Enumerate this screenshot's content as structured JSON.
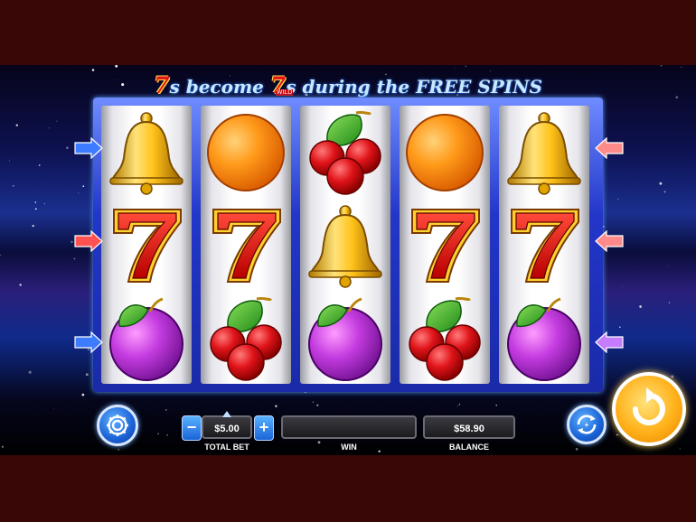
{
  "banner": {
    "seven_glyph": "7",
    "part1": "s become ",
    "wild_tag": "WILD",
    "part2": "s during the FREE SPINS"
  },
  "reels": [
    [
      "bell",
      "seven",
      "plum"
    ],
    [
      "orange",
      "seven",
      "cherry"
    ],
    [
      "cherry",
      "bell",
      "plum"
    ],
    [
      "orange",
      "seven",
      "cherry"
    ],
    [
      "bell",
      "seven",
      "plum"
    ]
  ],
  "paylines": {
    "left": [
      "blue",
      "red",
      "blue"
    ],
    "right": [
      "pink",
      "pink",
      "purple"
    ]
  },
  "colors": {
    "blue": "#3d7bff",
    "red": "#ff5252",
    "pink": "#ff8a8a",
    "purple": "#c67cff"
  },
  "controls": {
    "settings_icon": "gear-icon",
    "bet_minus": "−",
    "bet_plus": "+",
    "total_bet_value": "$5.00",
    "total_bet_label": "TOTAL BET",
    "win_value": "",
    "win_label": "WIN",
    "balance_value": "$58.90",
    "balance_label": "BALANCE",
    "autoplay_icon": "autoplay-icon",
    "spin_icon": "spin-arrow-icon"
  }
}
